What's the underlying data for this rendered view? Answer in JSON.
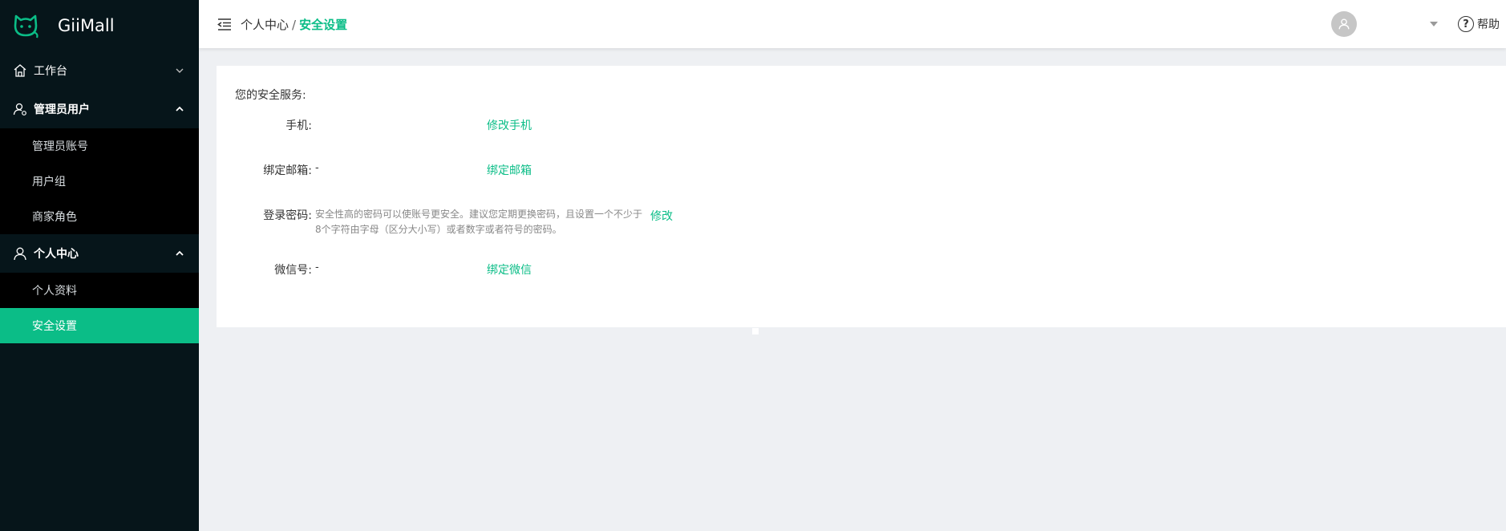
{
  "app": {
    "name": "GiiMall"
  },
  "sidebar": {
    "groups": [
      {
        "label": "工作台",
        "expanded": false,
        "items": []
      },
      {
        "label": "管理员用户",
        "expanded": true,
        "items": [
          {
            "label": "管理员账号"
          },
          {
            "label": "用户组"
          },
          {
            "label": "商家角色"
          }
        ]
      },
      {
        "label": "个人中心",
        "expanded": true,
        "items": [
          {
            "label": "个人资料"
          },
          {
            "label": "安全设置",
            "active": true
          }
        ]
      }
    ]
  },
  "header": {
    "breadcrumb": {
      "parent": "个人中心",
      "separator": "/",
      "current": "安全设置"
    },
    "help_label": "帮助",
    "help_glyph": "?"
  },
  "security": {
    "title": "您的安全服务:",
    "phone": {
      "label": "手机:",
      "value": "",
      "action": "修改手机"
    },
    "email": {
      "label": "绑定邮箱:",
      "value": "-",
      "action": "绑定邮箱"
    },
    "password": {
      "label": "登录密码:",
      "description": "安全性高的密码可以使账号更安全。建议您定期更换密码，且设置一个不少于8个字符由字母（区分大小写）或者数字或者符号的密码。",
      "action": "修改"
    },
    "wechat": {
      "label": "微信号:",
      "value": "-",
      "action": "绑定微信"
    }
  },
  "colors": {
    "accent": "#0bbd87",
    "sidebar_bg": "#06151a",
    "submenu_bg": "#000000",
    "page_bg": "#eef0f3"
  },
  "icons": {
    "logo": "cat-logo-icon",
    "home": "home-icon",
    "admin": "user-gear-icon",
    "personal": "user-icon",
    "collapse": "menu-fold-icon",
    "avatar": "avatar-icon",
    "caret": "caret-down-icon",
    "help": "question-circle-icon"
  }
}
